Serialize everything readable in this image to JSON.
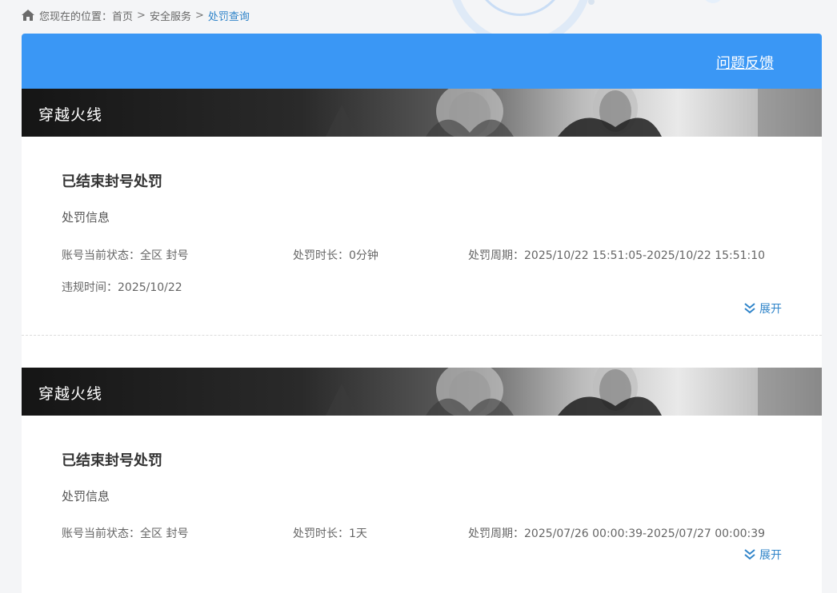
{
  "breadcrumb": {
    "prefix": "您现在的位置：",
    "items": [
      "首页",
      "安全服务",
      "处罚查询"
    ],
    "separator": ">"
  },
  "header": {
    "feedback_label": "问题反馈"
  },
  "colors": {
    "header_bg": "#3a97f5",
    "link": "#2f84c9"
  },
  "records": [
    {
      "game": "穿越火线",
      "title": "已结束封号处罚",
      "section_label": "处罚信息",
      "status_label": "账号当前状态：",
      "status_value": "全区 封号",
      "duration_label": "处罚时长：",
      "duration_value": "0分钟",
      "period_label": "处罚周期：",
      "period_value": "2025/10/22 15:51:05-2025/10/22 15:51:10",
      "violation_label": "违规时间：",
      "violation_value": "2025/10/22",
      "expand_label": "展开"
    },
    {
      "game": "穿越火线",
      "title": "已结束封号处罚",
      "section_label": "处罚信息",
      "status_label": "账号当前状态：",
      "status_value": "全区 封号",
      "duration_label": "处罚时长：",
      "duration_value": "1天",
      "period_label": "处罚周期：",
      "period_value": "2025/07/26 00:00:39-2025/07/27 00:00:39",
      "expand_label": "展开"
    }
  ]
}
